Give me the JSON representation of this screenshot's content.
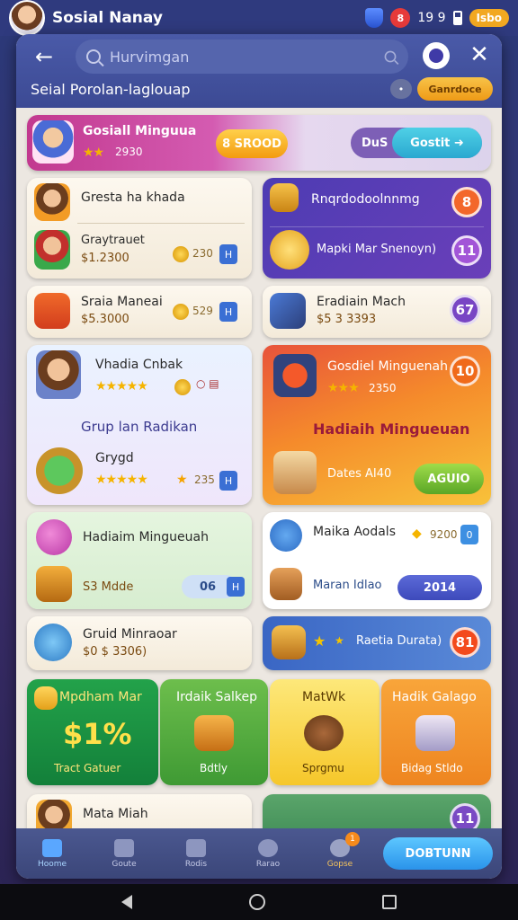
{
  "status": {
    "app_name": "Sosial Nanay",
    "time": "19 9",
    "badge": "8",
    "coin_pill": "Isbo"
  },
  "header": {
    "search_placeholder": "Hurvimgan",
    "subtitle": "Seial Porolan-laglouap",
    "small_pill": "•",
    "orange_pill": "Ganrdoce"
  },
  "banner": {
    "title": "Gosiall Minguua",
    "rating": "2930",
    "stars": "★★",
    "pill_label": "8 SROOD",
    "right_left": "DuS",
    "right_btn": "Gostit"
  },
  "row1": {
    "left_title": "Gresta ha khada",
    "left_item_title": "Graytrauet",
    "left_item_value": "$1.2300",
    "left_item_count": "230",
    "right_title": "Rnqrdodoolnnmg",
    "right_title_badge": "8",
    "right_sub": "Mapki Mar Snenoyn)",
    "right_sub_badge": "11"
  },
  "row2": {
    "left_title": "Sraia Maneai",
    "left_value": "$5.3000",
    "left_count": "529",
    "right_title": "Eradiain Mach",
    "right_value": "$5 3 3393",
    "right_badge": "67"
  },
  "row3": {
    "left_title": "Vhadia Cnbak",
    "left_stars": "★★★★★",
    "left_mid": "Grup lan Radikan",
    "left_item": "Grygd",
    "left_item_stars": "★★★★★",
    "left_item_count": "235",
    "right_title": "Gosdiel Minguenah",
    "right_stars": "★★★",
    "right_rating": "2350",
    "right_badge": "10",
    "right_mid": "Hadiaih Mingueuan",
    "right_footer": "Dates AI40",
    "right_btn": "AGUIO"
  },
  "row4": {
    "left_title": "Hadiaim Mingueuah",
    "left_value": "S3 Mdde",
    "left_count": "06",
    "right_title": "Maika Aodals",
    "right_value": "9200",
    "right_sub": "Maran Idlao",
    "right_sub_value": "2014"
  },
  "row5": {
    "left_title": "Gruid Minraoar",
    "left_value": "$0 $ 3306)",
    "right_label": "Raetia Durata)",
    "right_badge": "81"
  },
  "tiles": [
    {
      "title": "Mpdham Mar",
      "big": "$1%",
      "footer": "Tract Gatuer"
    },
    {
      "title": "Irdaik Salkep",
      "footer": "Bdtly"
    },
    {
      "title": "MatWk",
      "footer": "Sprgmu"
    },
    {
      "title": "Hadik Galago",
      "footer": "Bidag Stldo"
    }
  ],
  "row6": {
    "left_title": "Mata Miah",
    "right_badge": "11"
  },
  "nav": {
    "items": [
      "Hoome",
      "Goute",
      "Rodis",
      "Rarao",
      "Gopse"
    ],
    "games_badge": "1",
    "big_btn": "DOBTUNN"
  }
}
